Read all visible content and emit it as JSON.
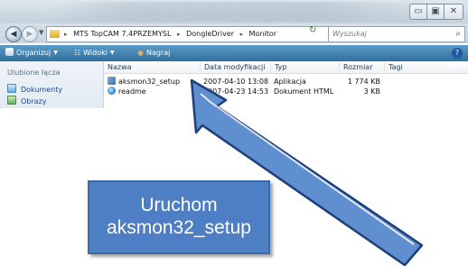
{
  "window": {
    "controls": {
      "minimize": "▭",
      "maximize": "▣",
      "close": "✕"
    }
  },
  "address_bar": {
    "back_glyph": "◀",
    "forward_glyph": "▶",
    "breadcrumbs": [
      "MTS TopCAM 7.4PRZEMYSL",
      "DongleDriver",
      "Monitor"
    ],
    "separator": "▸",
    "refresh_glyph": "↻"
  },
  "search": {
    "placeholder": "Wyszukaj",
    "icon": "search-icon"
  },
  "toolbar": {
    "organize_label": "Organizuj",
    "views_label": "Widoki",
    "burn_label": "Nagraj",
    "caret": "▼",
    "help_glyph": "?"
  },
  "nav_pane": {
    "title": "Ulubione łącza",
    "items": [
      {
        "label": "Dokumenty",
        "icon": "documents-icon"
      },
      {
        "label": "Obrazy",
        "icon": "pictures-icon"
      }
    ]
  },
  "file_list": {
    "columns": [
      "Nazwa",
      "Data modyfikacji",
      "Typ",
      "Rozmiar",
      "Tagi"
    ],
    "rows": [
      {
        "name": "aksmon32_setup",
        "modified": "2007-04-10 13:08",
        "type": "Aplikacja",
        "size": "1 774 KB",
        "icon": "application-icon"
      },
      {
        "name": "readme",
        "modified": "2007-04-23 14:53",
        "type": "Dokument HTML",
        "size": "3 KB",
        "icon": "html-document-icon"
      }
    ]
  },
  "callout": {
    "line1": "Uruchom",
    "line2": "aksmon32_setup"
  },
  "colors": {
    "callout_fill": "#4e7ec3",
    "arrow_fill": "#5f8fcf",
    "arrow_outline": "#1f3f7a",
    "toolbar": "#3a7bad"
  }
}
